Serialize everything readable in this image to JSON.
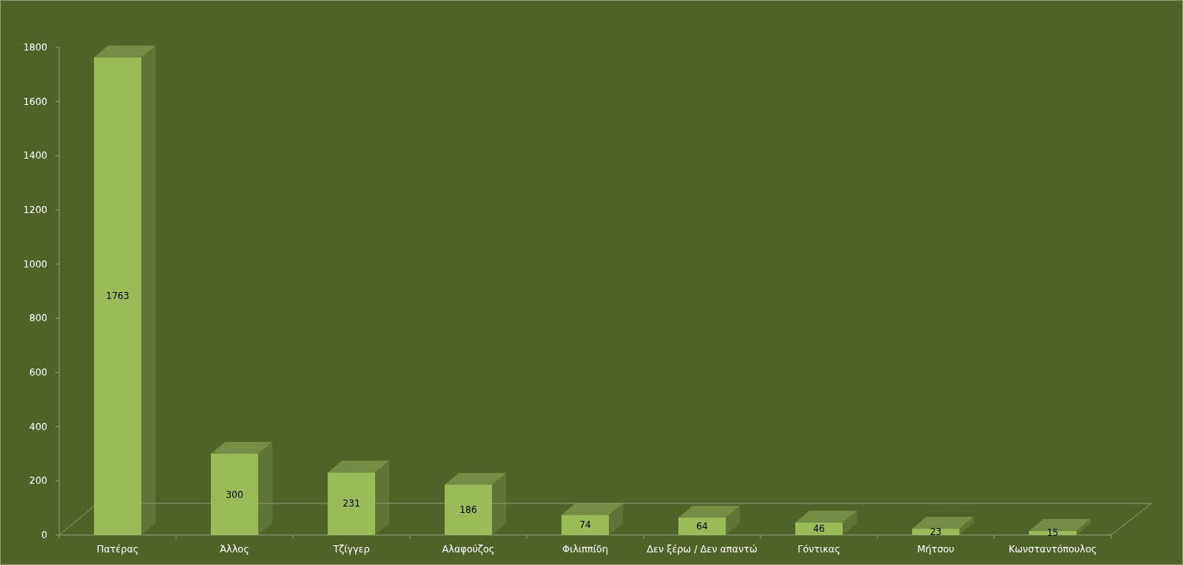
{
  "chart_data": {
    "type": "bar",
    "categories": [
      "Πατέρας",
      "Άλλος",
      "Τζίγγερ",
      "Αλαφούζος",
      "Φιλιππίδη",
      "Δεν ξέρω / Δεν απαντώ",
      "Γόντικας",
      "Μήτσου",
      "Κωνσταντόπουλος"
    ],
    "series": [
      {
        "color": "#9bbb59",
        "values": [
          1763,
          300,
          231,
          186,
          74,
          64,
          46,
          23,
          15
        ]
      }
    ],
    "ylim": [
      0,
      1800
    ],
    "yticks": [
      0,
      200,
      400,
      600,
      800,
      1000,
      1200,
      1400,
      1600,
      1800
    ],
    "value_labels": [
      "1763",
      "300",
      "231",
      "186",
      "74",
      "64",
      "46",
      "23",
      "15"
    ]
  }
}
